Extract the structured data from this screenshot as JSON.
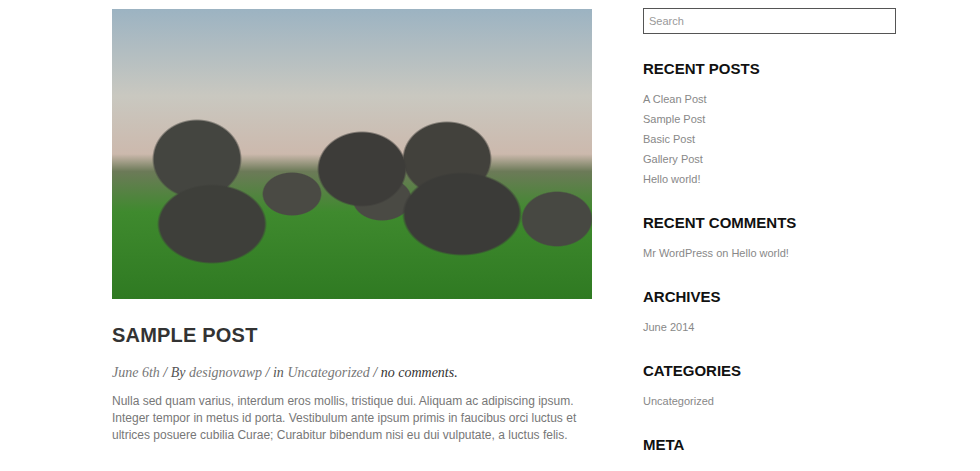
{
  "post": {
    "title": "SAMPLE POST",
    "meta": [
      {
        "text": "June 6th",
        "kind": "link"
      },
      {
        "text": " / By ",
        "kind": "plain"
      },
      {
        "text": "designovawp",
        "kind": "link"
      },
      {
        "text": " / in ",
        "kind": "plain"
      },
      {
        "text": "Uncategorized",
        "kind": "link"
      },
      {
        "text": " / ",
        "kind": "plain"
      },
      {
        "text": "no comments.",
        "kind": "link"
      }
    ],
    "body": "Nulla sed quam varius, interdum eros mollis, tristique dui. Aliquam ac adipiscing ipsum. Integer tempor in metus id porta. Vestibulum ante ipsum primis in faucibus orci luctus et ultrices posuere cubilia Curae; Curabitur bibendum nisi eu dui vulputate, a luctus felis."
  },
  "sidebar": {
    "search": {
      "placeholder": "Search"
    },
    "widgets": [
      {
        "title": "RECENT POSTS",
        "items": [
          "A Clean Post",
          "Sample Post",
          "Basic Post",
          "Gallery Post",
          "Hello world!"
        ]
      },
      {
        "title": "RECENT COMMENTS",
        "items": [
          "Mr WordPress on Hello world!"
        ]
      },
      {
        "title": "ARCHIVES",
        "items": [
          "June 2014"
        ]
      },
      {
        "title": "CATEGORIES",
        "items": [
          "Uncategorized"
        ]
      },
      {
        "title": "META",
        "items": []
      }
    ]
  }
}
